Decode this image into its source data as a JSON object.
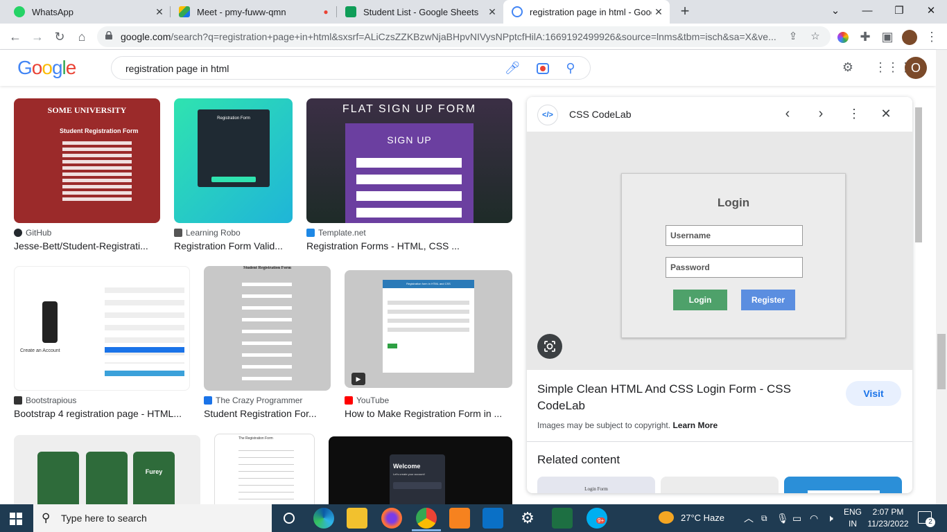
{
  "tabs": [
    {
      "title": "WhatsApp",
      "color": "#25d366"
    },
    {
      "title": "Meet - pmy-fuww-qmn",
      "color": "#00897b"
    },
    {
      "title": "Student List - Google Sheets",
      "color": "#0f9d58"
    },
    {
      "title": "registration page in html - Googl",
      "color": "#4285f4"
    }
  ],
  "address_bar": {
    "domain": "google.com",
    "path": "/search?q=registration+page+in+html&sxsrf=ALiCzsZZKBzwNjaBHpvNIVysNPptcfHilA:1669192499926&source=lnms&tbm=isch&sa=X&ve..."
  },
  "google": {
    "logo": "Google",
    "query": "registration page in html",
    "avatar_letter": "O"
  },
  "results": [
    {
      "source": "GitHub",
      "title": "Jesse-Bett/Student-Registrati...",
      "thumb_text": "SOME UNIVERSITY",
      "thumb_sub": "Student Registration Form"
    },
    {
      "source": "Learning Robo",
      "title": "Registration Form Valid...",
      "thumb_text": "Registration Form"
    },
    {
      "source": "Template.net",
      "title": "Registration Forms - HTML, CSS ...",
      "thumb_text": "FLAT SIGN UP FORM",
      "thumb_sub": "SIGN UP"
    },
    {
      "source": "Bootstrapious",
      "title": "Bootstrap 4 registration page - HTML...",
      "thumb_text": "Create an Account"
    },
    {
      "source": "The Crazy Programmer",
      "title": "Student Registration For...",
      "thumb_text": "Student Registration Form"
    },
    {
      "source": "YouTube",
      "title": "How to Make Registration Form in ...",
      "thumb_text": "Registration form in HTML and CSS"
    },
    {
      "source": "",
      "title": "",
      "thumb_text": "Furey"
    },
    {
      "source": "",
      "title": "",
      "thumb_text": "The Registration Form"
    },
    {
      "source": "",
      "title": "",
      "thumb_text": "Welcome",
      "thumb_sub": "Let's create your account!"
    }
  ],
  "preview": {
    "site": "CSS CodeLab",
    "login_title": "Login",
    "username_placeholder": "Username",
    "password_placeholder": "Password",
    "login_btn": "Login",
    "register_btn": "Register",
    "title": "Simple Clean HTML And CSS Login Form - CSS CodeLab",
    "visit": "Visit",
    "copyright": "Images may be subject to copyright.",
    "learn_more": "Learn More",
    "related": "Related content",
    "related_thumb_text": "Login Form"
  },
  "taskbar": {
    "search_placeholder": "Type here to search",
    "weather": "27°C  Haze",
    "lang1": "ENG",
    "lang2": "IN",
    "time": "2:07 PM",
    "date": "11/23/2022",
    "notifications": "2",
    "skype_badge": "9+"
  }
}
